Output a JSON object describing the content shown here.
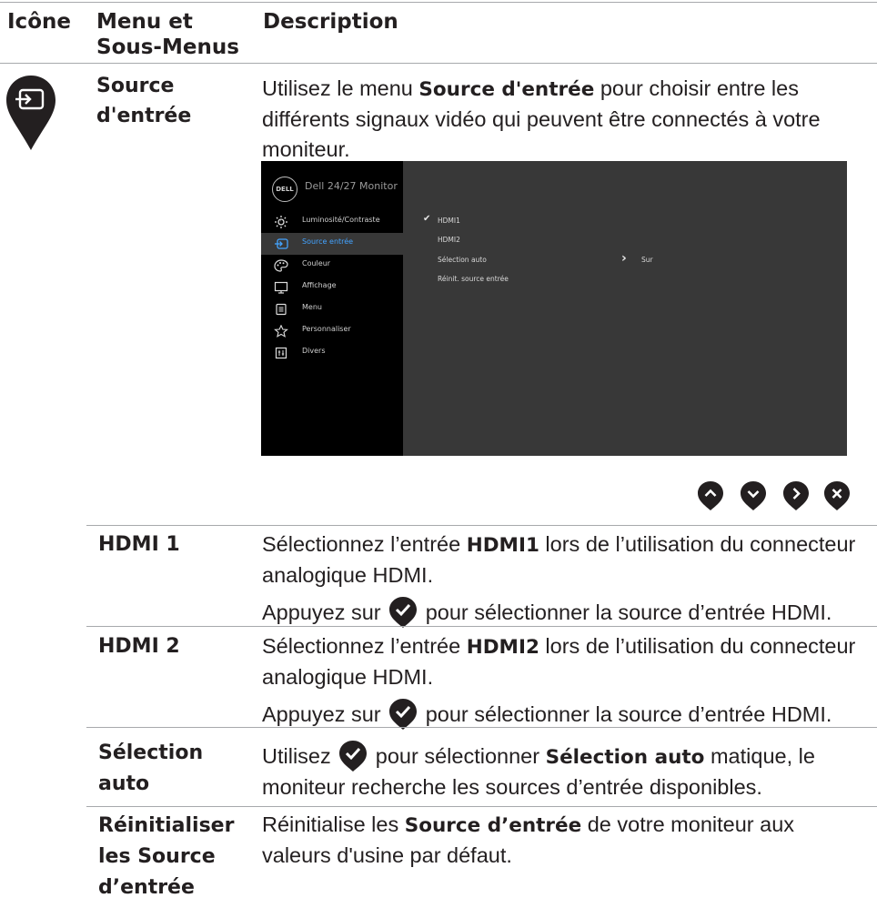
{
  "table": {
    "headers": {
      "icon": "Icône",
      "menu_line1": "Menu et",
      "menu_line2": "Sous-Menus",
      "description": "Description"
    },
    "section": {
      "menu_line1": "Source",
      "menu_line2": "d'entrée",
      "desc_pre": "Utilisez le menu ",
      "desc_bold": "Source d'entrée",
      "desc_post": " pour choisir entre les différents signaux vidéo qui peuvent être connectés à votre moniteur.",
      "icon": "input-source-icon"
    },
    "rows": [
      {
        "menu": "HDMI 1",
        "line1_pre": "Sélectionnez l’entrée ",
        "line1_bold": "HDMI1",
        "line1_post": " lors de l’utilisation du connecteur analogique HDMI.",
        "line2_pre": "Appuyez sur",
        "line2_post": "pour sélectionner la source d’entrée HDMI."
      },
      {
        "menu": "HDMI 2",
        "line1_pre": "Sélectionnez l’entrée ",
        "line1_bold": "HDMI2",
        "line1_post": " lors de l’utilisation du connecteur analogique HDMI.",
        "line2_pre": "Appuyez sur",
        "line2_post": "pour sélectionner la source d’entrée HDMI."
      },
      {
        "menu_line1": "Sélection",
        "menu_line2": "auto",
        "pre": "Utilisez",
        "mid": "pour sélectionner ",
        "bold": "Sélection auto",
        "post": " matique, le moniteur recherche les sources d’entrée disponibles."
      },
      {
        "menu_line1": "Réinitialiser",
        "menu_line2": "les Source",
        "menu_line3": "d’entrée",
        "pre": "Réinitialise les ",
        "bold": "Source d’entrée",
        "post": " de votre moniteur aux valeurs d'usine par défaut."
      }
    ]
  },
  "osd": {
    "logo": "DELL",
    "title": "Dell 24/27 Monitor",
    "menu": [
      {
        "label": "Luminosité/Contraste",
        "icon": "brightness-icon"
      },
      {
        "label": "Source entrée",
        "icon": "input-icon",
        "active": true
      },
      {
        "label": "Couleur",
        "icon": "palette-icon"
      },
      {
        "label": "Affichage",
        "icon": "display-icon"
      },
      {
        "label": "Menu",
        "icon": "menu-icon"
      },
      {
        "label": "Personnaliser",
        "icon": "star-icon"
      },
      {
        "label": "Divers",
        "icon": "others-icon"
      }
    ],
    "options": [
      {
        "label": "HDMI1",
        "checked": true
      },
      {
        "label": "HDMI2"
      },
      {
        "label": "Sélection auto",
        "value": "Sur"
      },
      {
        "label": "Réinit. source entrée"
      }
    ],
    "chevron": "›"
  },
  "buttons": [
    "up-button-icon",
    "down-button-icon",
    "right-button-icon",
    "exit-button-icon"
  ],
  "colors": {
    "text": "#231f20",
    "rule": "#a7a9ac",
    "osd_bg": "#383838",
    "osd_left": "#000000",
    "highlight": "#43a3ff"
  }
}
